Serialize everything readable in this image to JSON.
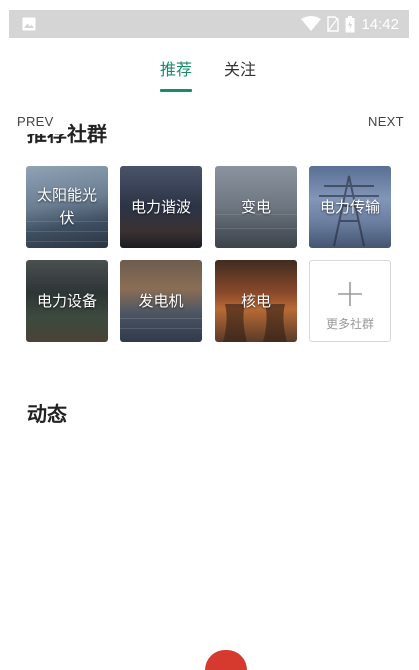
{
  "status_bar": {
    "time": "14:42"
  },
  "tabs": [
    {
      "label": "推荐",
      "active": true
    },
    {
      "label": "关注",
      "active": false
    }
  ],
  "nav": {
    "prev": "PREV",
    "next": "NEXT"
  },
  "sections": {
    "communities_title": "推荐社群",
    "feed_title": "动态"
  },
  "communities": [
    {
      "label": "太阳能光伏"
    },
    {
      "label": "电力谐波"
    },
    {
      "label": "变电"
    },
    {
      "label": "电力传输"
    },
    {
      "label": "电力设备"
    },
    {
      "label": "发电机"
    },
    {
      "label": "核电"
    }
  ],
  "more": {
    "label": "更多社群",
    "icon": "plus-icon"
  },
  "colors": {
    "accent": "#1b8a6b",
    "status_bar": "#d5d5d5"
  }
}
